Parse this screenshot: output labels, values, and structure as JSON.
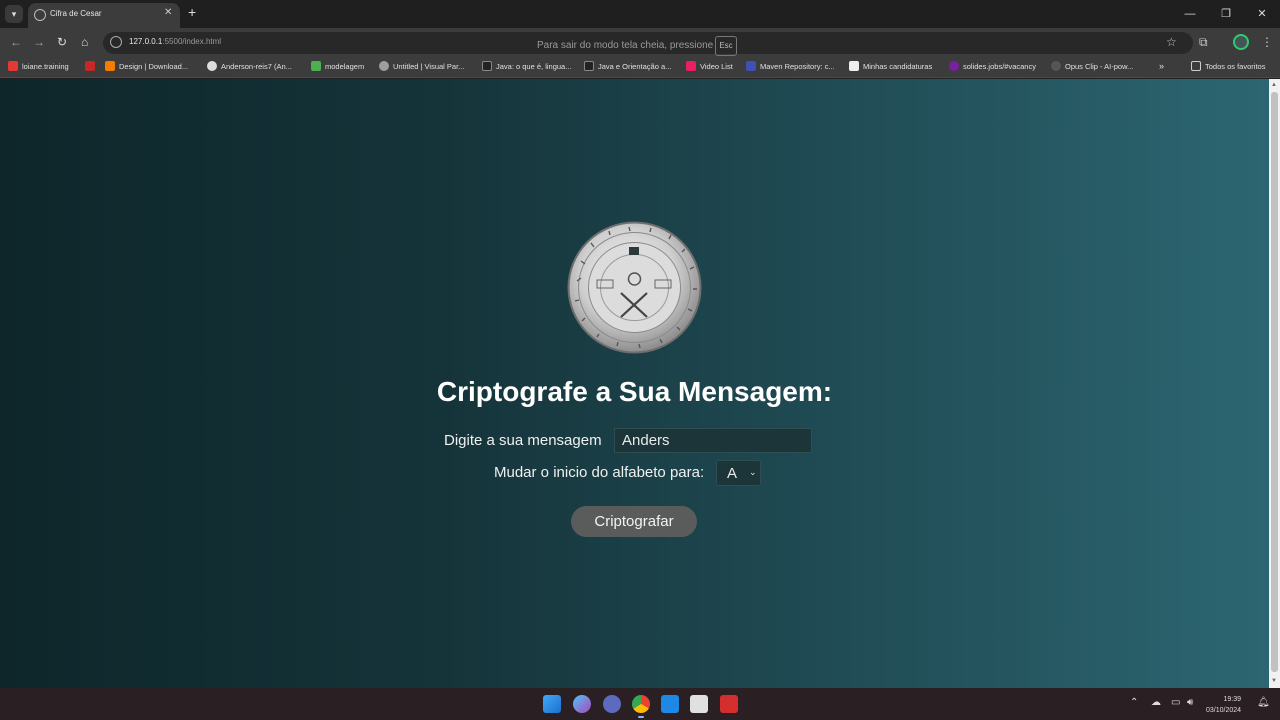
{
  "browser": {
    "tab_title": "Cifra de Cesar",
    "url_host": "127.0.0.1",
    "url_path": ":5500/index.html",
    "fullscreen_hint": "Para sair do modo tela cheia, pressione",
    "esc_key": "Esc",
    "bookmarks": [
      {
        "label": "loiane.training",
        "color": "#e53935"
      },
      {
        "label": "Design | Download...",
        "color": "#f57c00"
      },
      {
        "label": "Anderson-reis7 (An...",
        "color": "#dddddd"
      },
      {
        "label": "modelagem",
        "color": "#4caf50"
      },
      {
        "label": "Untitled | Visual Par...",
        "color": "#9e9e9e"
      },
      {
        "label": "Java: o que é, lingua...",
        "color": "#222222"
      },
      {
        "label": "Java e Orientação a...",
        "color": "#222222"
      },
      {
        "label": "Video List",
        "color": "#e91e63"
      },
      {
        "label": "Maven Repository: c...",
        "color": "#3f51b5"
      },
      {
        "label": "Minhas candidaturas",
        "color": "#eeeeee"
      },
      {
        "label": "solides.jobs/#vacancy",
        "color": "#7b1fa2"
      },
      {
        "label": "Opus Clip - AI-pow...",
        "color": "#555555"
      }
    ],
    "all_bookmarks": "Todos os favoritos"
  },
  "page": {
    "heading": "Criptografe a Sua Mensagem:",
    "message_label": "Digite a sua mensagem",
    "message_value": "Anders",
    "shift_label": "Mudar o inicio do alfabeto para:",
    "shift_value": "A",
    "encrypt_button": "Criptografar"
  },
  "taskbar": {
    "time": "19:39",
    "date": "03/10/2024"
  },
  "colors": {
    "page_gradient_start": "#0e262a",
    "page_gradient_end": "#2c6671",
    "button_bg": "#5a5c5c"
  }
}
